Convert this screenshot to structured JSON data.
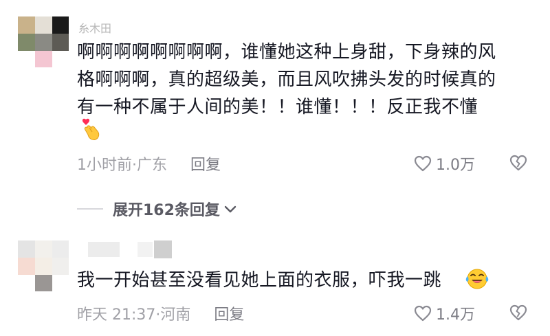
{
  "comments": [
    {
      "username": "糸木田",
      "text_lines": [
        "啊啊啊啊啊啊啊啊，谁懂她这种上身甜，下身辣的风",
        "格啊啊啊，真的超级美，而且风吹拂头发的时候真的",
        "有一种不属于人间的美！！谁懂！！！反正我不懂"
      ],
      "emoji": "finger-heart-emoji",
      "time_location": "1小时前·广东",
      "reply_label": "回复",
      "like_count": "1.0万"
    },
    {
      "username": "",
      "text_lines": [
        "我一开始甚至没看见她上面的衣服，吓我一跳"
      ],
      "emoji": "crying-laughing-emoji",
      "time_location": "昨天 21:37·河南",
      "reply_label": "回复",
      "like_count": "1.4万"
    }
  ],
  "expand_replies_label": "展开162条回复",
  "icons": {
    "like": "heart-outline-icon",
    "dislike": "broken-heart-outline-icon",
    "expand": "chevron-down-icon"
  },
  "colors": {
    "text": "#161823",
    "meta": "#a0a0a6",
    "reply": "#7d7d85",
    "expand": "#5a5a63"
  }
}
